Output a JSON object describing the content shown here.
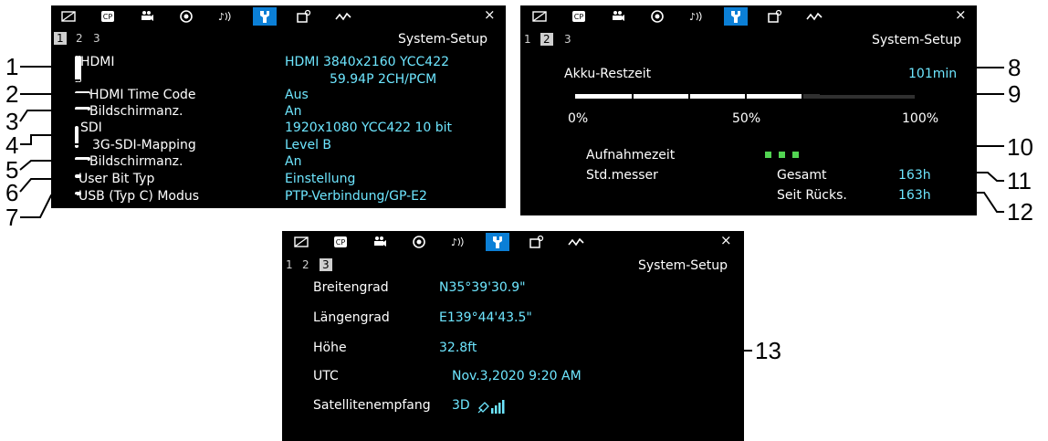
{
  "tabs_close": "×",
  "panel1": {
    "pages": [
      "1",
      "2",
      "3"
    ],
    "title": "System-Setup",
    "rows": [
      {
        "label": "HDMI",
        "value": "HDMI   3840x2160 YCC422"
      },
      {
        "label": "",
        "value": "59.94P   2CH/PCM"
      },
      {
        "label": "HDMI Time Code",
        "value": "Aus"
      },
      {
        "label": "Bildschirmanz.",
        "value": "An"
      },
      {
        "label": "SDI",
        "value": "1920x1080 YCC422 10 bit"
      },
      {
        "label": "3G-SDI-Mapping",
        "value": "Level B"
      },
      {
        "label": "Bildschirmanz.",
        "value": "An"
      },
      {
        "label": "User Bit Typ",
        "value": "Einstellung"
      },
      {
        "label": "USB (Typ C) Modus",
        "value": "PTP-Verbindung/GP-E2"
      }
    ]
  },
  "panel2": {
    "pages": [
      "1",
      "2",
      "3"
    ],
    "title": "System-Setup",
    "battery_label": "Akku-Restzeit",
    "battery_value": "101min",
    "battery_level": 0.67,
    "scale": [
      "0%",
      "50%",
      "100%"
    ],
    "rec_label": "Aufnahmezeit",
    "hour_label": "Std.messer",
    "total_label": "Gesamt",
    "total_value": "163h",
    "since_label": "Seit Rücks.",
    "since_value": "163h",
    "accent_green": "#52d452"
  },
  "panel3": {
    "pages": [
      "1",
      "2",
      "3"
    ],
    "title": "System-Setup",
    "rows": [
      {
        "label": "Breitengrad",
        "value": "N35°39'30.9\""
      },
      {
        "label": "Längengrad",
        "value": "E139°44'43.5\""
      },
      {
        "label": "Höhe",
        "value": "32.8ft"
      },
      {
        "label": "UTC",
        "value": "Nov.3,2020 9:20 AM"
      },
      {
        "label": "Satellitenempfang",
        "value": "3D"
      }
    ]
  },
  "callouts": [
    "1",
    "2",
    "3",
    "4",
    "5",
    "6",
    "7",
    "8",
    "9",
    "10",
    "11",
    "12",
    "13"
  ],
  "colors": {
    "accent": "#0b7fd6",
    "value": "#6ee6ff",
    "background": "#000000"
  }
}
